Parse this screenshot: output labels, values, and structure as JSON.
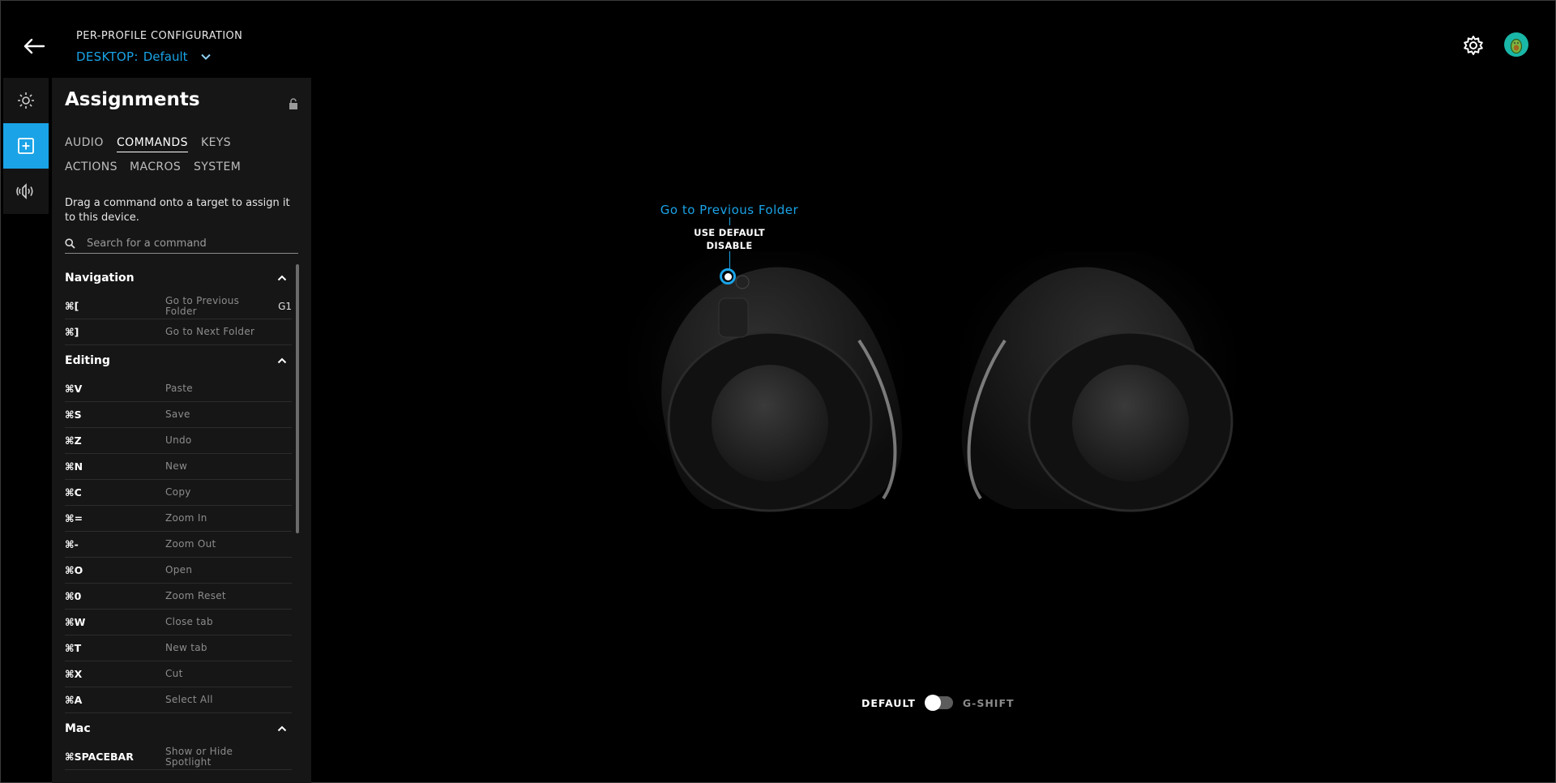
{
  "header": {
    "profile_label": "PER-PROFILE CONFIGURATION",
    "device_prefix": "DESKTOP:",
    "profile_name": "Default"
  },
  "panel": {
    "title": "Assignments",
    "tabs": [
      "AUDIO",
      "COMMANDS",
      "KEYS",
      "ACTIONS",
      "MACROS",
      "SYSTEM"
    ],
    "active_tab": "COMMANDS",
    "hint": "Drag a command onto a target to assign it to this device.",
    "search_placeholder": "Search for a command",
    "sections": [
      {
        "name": "Navigation",
        "rows": [
          {
            "key": "⌘[",
            "command": "Go to Previous Folder",
            "assigned": "G1"
          },
          {
            "key": "⌘]",
            "command": "Go to Next Folder",
            "assigned": ""
          }
        ]
      },
      {
        "name": "Editing",
        "rows": [
          {
            "key": "⌘V",
            "command": "Paste",
            "assigned": ""
          },
          {
            "key": "⌘S",
            "command": "Save",
            "assigned": ""
          },
          {
            "key": "⌘Z",
            "command": "Undo",
            "assigned": ""
          },
          {
            "key": "⌘N",
            "command": "New",
            "assigned": ""
          },
          {
            "key": "⌘C",
            "command": "Copy",
            "assigned": ""
          },
          {
            "key": "⌘=",
            "command": "Zoom In",
            "assigned": ""
          },
          {
            "key": "⌘-",
            "command": "Zoom Out",
            "assigned": ""
          },
          {
            "key": "⌘O",
            "command": "Open",
            "assigned": ""
          },
          {
            "key": "⌘0",
            "command": "Zoom Reset",
            "assigned": ""
          },
          {
            "key": "⌘W",
            "command": "Close tab",
            "assigned": ""
          },
          {
            "key": "⌘T",
            "command": "New tab",
            "assigned": ""
          },
          {
            "key": "⌘X",
            "command": "Cut",
            "assigned": ""
          },
          {
            "key": "⌘A",
            "command": "Select All",
            "assigned": ""
          }
        ]
      },
      {
        "name": "Mac",
        "rows": [
          {
            "key": "⌘SPACEBAR",
            "command": "Show or Hide Spotlight",
            "assigned": ""
          }
        ]
      }
    ]
  },
  "device": {
    "button_assignment": "Go to Previous Folder",
    "options": [
      "USE DEFAULT",
      "DISABLE"
    ]
  },
  "mode_toggle": {
    "left_label": "DEFAULT",
    "right_label": "G-SHIFT"
  },
  "colors": {
    "accent": "#1aa3e6",
    "background": "#000000",
    "panel": "#161616"
  },
  "icons": {
    "back": "arrow-left-icon",
    "profile_dropdown": "chevron-down-icon",
    "settings": "gear-icon",
    "avatar": "avocado-avatar-icon",
    "rail": [
      "lighting-sun-icon",
      "assignments-plus-icon",
      "audio-speaker-icon"
    ],
    "lock": "lock-icon",
    "search": "search-icon",
    "section_toggle": "chevron-up-icon"
  }
}
